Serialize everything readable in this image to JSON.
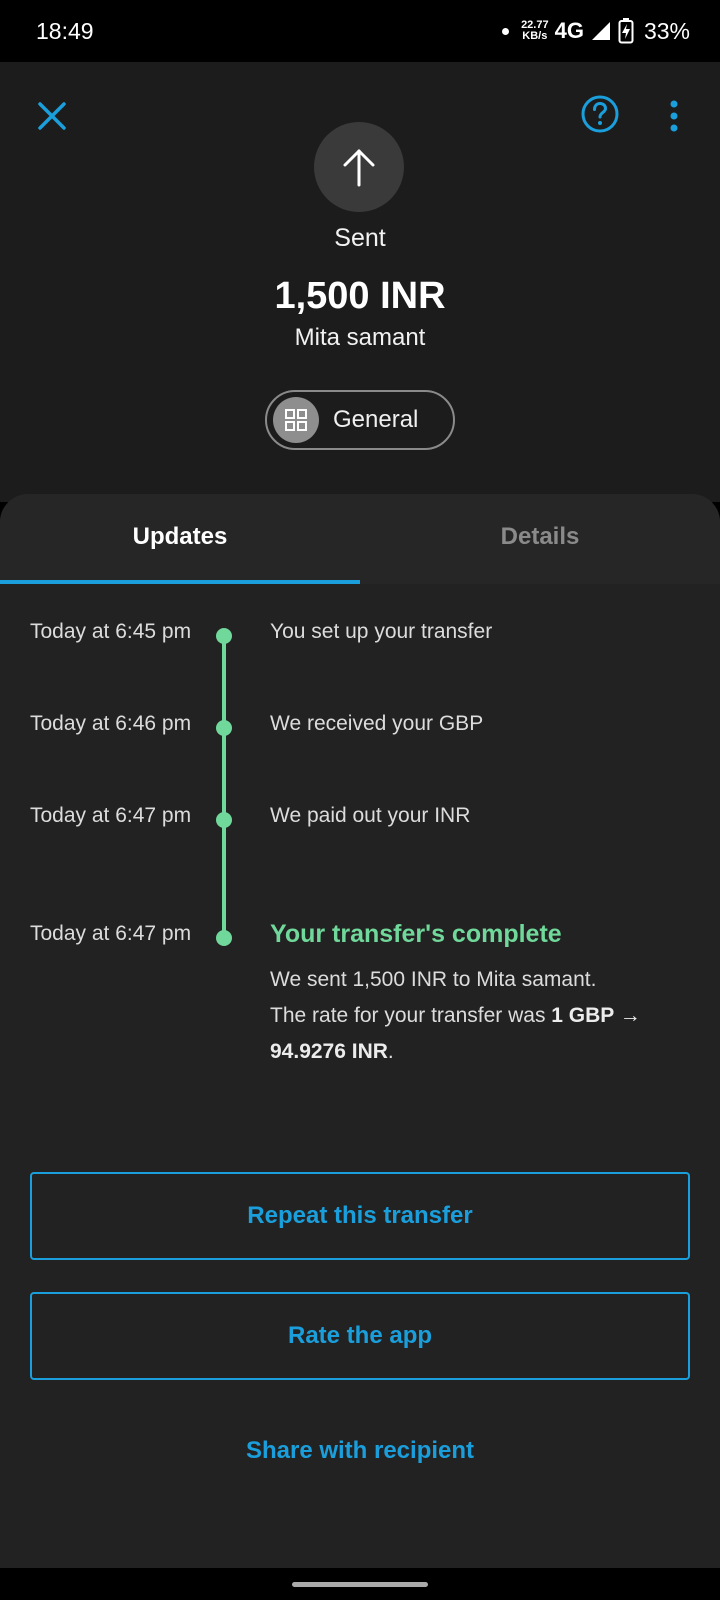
{
  "status_bar": {
    "time": "18:49",
    "speed_value": "22.77",
    "speed_unit": "KB/s",
    "network": "4G",
    "battery": "33%"
  },
  "header": {
    "close_icon": "close-icon",
    "help_icon": "help-icon",
    "more_icon": "more-vert-icon",
    "status": "Sent",
    "amount": "1,500 INR",
    "recipient": "Mita samant",
    "category": "General"
  },
  "tabs": [
    {
      "label": "Updates",
      "active": true
    },
    {
      "label": "Details",
      "active": false
    }
  ],
  "timeline": {
    "events": [
      {
        "time": "Today at 6:45 pm",
        "text": "You set up your transfer"
      },
      {
        "time": "Today at 6:46 pm",
        "text": "We received your GBP"
      },
      {
        "time": "Today at 6:47 pm",
        "text": "We paid out your INR"
      }
    ],
    "complete": {
      "time": "Today at 6:47 pm",
      "title": "Your transfer's complete",
      "line1": "We sent 1,500 INR to Mita samant.",
      "line2_prefix": "The rate for your transfer was",
      "rate": "1 GBP → 94.9276 INR",
      "line2_suffix": "."
    }
  },
  "actions": {
    "repeat": "Repeat this transfer",
    "rate": "Rate the app",
    "share": "Share with recipient"
  },
  "colors": {
    "accent": "#1a9fdc",
    "success": "#70d89a",
    "background": "#1c1c1c"
  }
}
